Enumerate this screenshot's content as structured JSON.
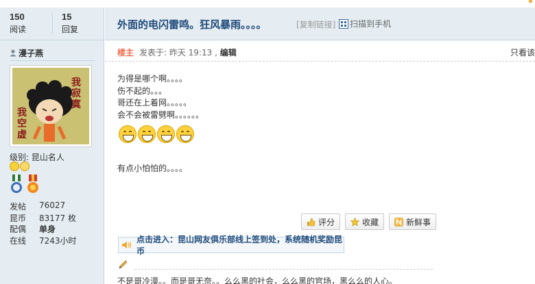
{
  "thread": {
    "views_count": "150",
    "views_label": "阅读",
    "replies_count": "15",
    "replies_label": "回复",
    "title": "外面的电闪雷鸣。狂风暴雨。。。。",
    "copy_link": "[复制链接]",
    "scan_to_phone": "扫描到手机"
  },
  "author": {
    "name": "漫子燕",
    "level": "级别: 昆山名人",
    "avatar_text": [
      "我",
      "寂",
      "寞",
      "我",
      "空",
      "虚"
    ],
    "info": [
      {
        "key": "发帖",
        "value": "76027"
      },
      {
        "key": "昆币",
        "value": "83177 枚"
      },
      {
        "key": "配偶",
        "value": "单身"
      },
      {
        "key": "在线",
        "value": "7243小时"
      }
    ]
  },
  "post": {
    "louzhu": "楼主",
    "posted_at": "发表于: 昨天 19:13 ,",
    "edit": "编辑",
    "only_view": "只看该",
    "lines": [
      "为得是哪个啊。。。。",
      "伤不起的。。。",
      "哥还在上着网。。。。。",
      "会不会被雷劈啊。。。。。。"
    ],
    "tail_line": "有点小怕怕的。。。。",
    "emoji_icon": "grin-emoji-icon",
    "emoji_count": 4
  },
  "actions": {
    "rate": "评分",
    "favorite": "收藏",
    "fresh": "新鲜事"
  },
  "notice": {
    "text": "点击进入：昆山网友俱乐部线上签到处，系统随机奖励昆币"
  },
  "signature": {
    "text": "不是哥冷漠。。而是哥无奈。。么么黑的社会，么么黑的官场，黑么么的人心。"
  },
  "colors": {
    "accent": "#1f4a7a",
    "panel_bg": "#e5edf2",
    "border": "#c2d5e3",
    "louzhu": "#f26c4f"
  }
}
